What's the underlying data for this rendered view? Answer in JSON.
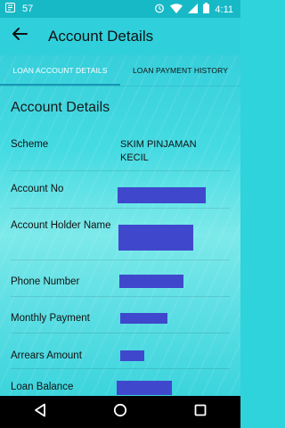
{
  "status_bar": {
    "notification_count": "57",
    "time": "4:11"
  },
  "app_bar": {
    "title": "Account Details"
  },
  "tabs": [
    {
      "label": "LOAN ACCOUNT DETAILS",
      "active": true
    },
    {
      "label": "LOAN PAYMENT HISTORY",
      "active": false
    }
  ],
  "section": {
    "title": "Account Details"
  },
  "details": [
    {
      "label": "Scheme",
      "value": "SKIM PINJAMAN KECIL"
    },
    {
      "label": "Account No",
      "value": ""
    },
    {
      "label": "Account Holder Name",
      "value": ""
    },
    {
      "label": "Phone Number",
      "value": ""
    },
    {
      "label": "Monthly Payment",
      "value": ""
    },
    {
      "label": "Arrears Amount",
      "value": ""
    },
    {
      "label": "Loan Balance",
      "value": ""
    }
  ],
  "colors": {
    "accent": "#2fd0dc",
    "status_bar": "#18b9c7",
    "redaction": "#3f48cc",
    "tab_indicator": "#1497b7"
  },
  "icons": {
    "back": "arrow-left-icon",
    "nav_back": "triangle-back-icon",
    "nav_home": "circle-home-icon",
    "nav_recents": "square-recents-icon"
  }
}
